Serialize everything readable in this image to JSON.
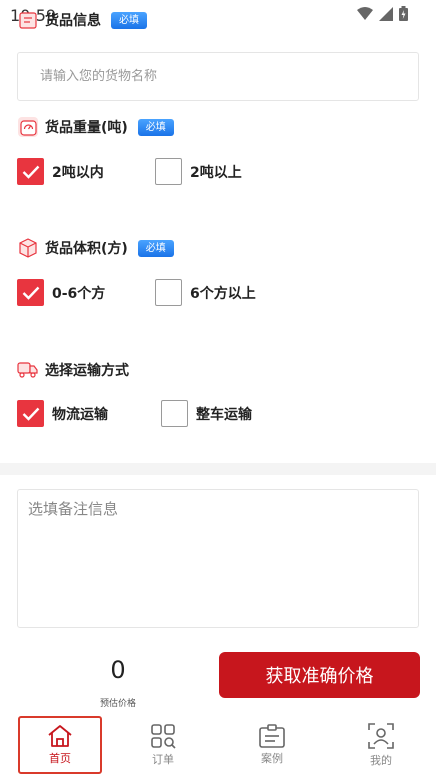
{
  "status_bar": {
    "time": "10:59"
  },
  "goods_info": {
    "title": "货品信息",
    "badge": "必填",
    "placeholder": "请输入您的货物名称"
  },
  "weight": {
    "title": "货品重量(吨)",
    "badge": "必填",
    "options": [
      {
        "label": "2吨以内",
        "checked": true
      },
      {
        "label": "2吨以上",
        "checked": false
      }
    ]
  },
  "volume": {
    "title": "货品体积(方)",
    "badge": "必填",
    "options": [
      {
        "label": "0-6个方",
        "checked": true
      },
      {
        "label": "6个方以上",
        "checked": false
      }
    ]
  },
  "transport": {
    "title": "选择运输方式",
    "options": [
      {
        "label": "物流运输",
        "checked": true
      },
      {
        "label": "整车运输",
        "checked": false
      }
    ]
  },
  "remark": {
    "placeholder": "选填备注信息"
  },
  "price": {
    "value": "0",
    "label": "预估价格"
  },
  "action": {
    "button_label": "获取准确价格"
  },
  "tabs": [
    {
      "label": "首页",
      "icon": "home-icon",
      "active": true
    },
    {
      "label": "订单",
      "icon": "order-grid-icon",
      "active": false
    },
    {
      "label": "案例",
      "icon": "case-clipboard-icon",
      "active": false
    },
    {
      "label": "我的",
      "icon": "profile-icon",
      "active": false
    }
  ],
  "colors": {
    "accent_red": "#c7161d",
    "check_red": "#e8353f",
    "badge_blue": "#1a73e8"
  }
}
